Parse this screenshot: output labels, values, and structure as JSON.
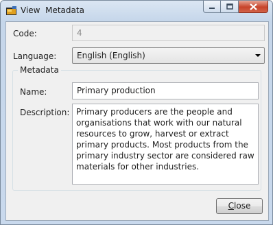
{
  "window": {
    "title": "View  Metadata",
    "icon": "folder-icon"
  },
  "caption_buttons": {
    "minimize_icon": "minimize-icon",
    "maximize_icon": "maximize-icon",
    "close_icon": "close-icon"
  },
  "form": {
    "code_label": "Code:",
    "code_value": "4",
    "language_label": "Language:",
    "language_value": "English (English)",
    "metadata_group_label": "Metadata",
    "name_label": "Name:",
    "name_value": "Primary production",
    "description_label": "Description:",
    "description_value": "Primary producers are the people and organisations that work with our natural resources to grow, harvest or extract primary products. Most products from the primary industry sector are considered raw materials for other industries."
  },
  "buttons": {
    "close_mnemonic": "C",
    "close_rest": "lose"
  },
  "colors": {
    "title_bar": "#c5d6ea",
    "client_bg": "#f0f0f0",
    "close_caption_button": "#c7432a"
  }
}
